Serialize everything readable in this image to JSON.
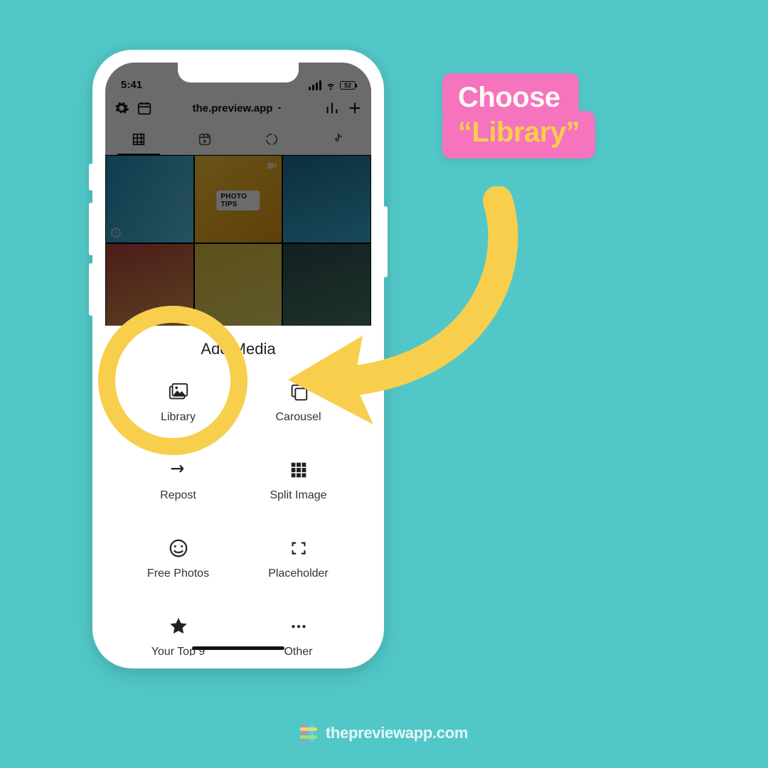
{
  "status": {
    "time": "5:41",
    "battery": "52"
  },
  "header": {
    "account": "the.preview.app"
  },
  "grid": {
    "badge": "PHOTO TIPS"
  },
  "sheet": {
    "title": "Add Media",
    "items": [
      {
        "label": "Library"
      },
      {
        "label": "Carousel"
      },
      {
        "label": "Repost"
      },
      {
        "label": "Split Image"
      },
      {
        "label": "Free Photos"
      },
      {
        "label": "Placeholder"
      },
      {
        "label": "Your Top 9"
      },
      {
        "label": "Other"
      }
    ]
  },
  "callout": {
    "line1": "Choose",
    "line2": "“Library”"
  },
  "watermark": {
    "text": "thepreviewapp.com"
  },
  "colors": {
    "bg": "#52c7c7",
    "accent": "#f8ce4d",
    "pink": "#f673bd"
  }
}
